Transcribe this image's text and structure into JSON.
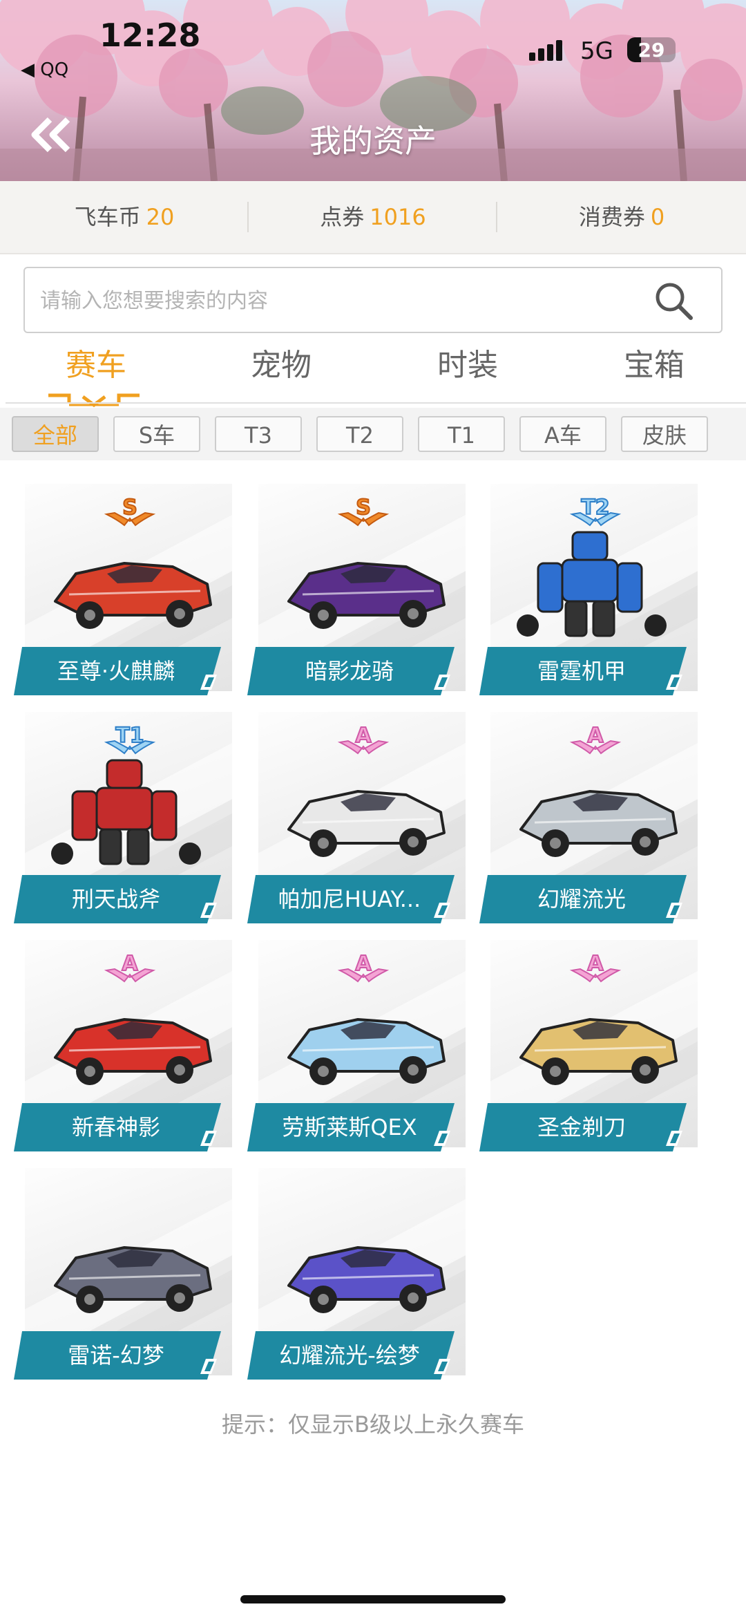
{
  "status": {
    "time": "12:28",
    "back_app": "◀ QQ",
    "network": "5G",
    "battery": "29",
    "battery_level": 0.29
  },
  "header": {
    "title": "我的资产"
  },
  "currency": [
    {
      "label": "飞车币",
      "value": "20"
    },
    {
      "label": "点券",
      "value": "1016"
    },
    {
      "label": "消费券",
      "value": "0"
    }
  ],
  "search": {
    "placeholder": "请输入您想要搜索的内容",
    "value": ""
  },
  "tabs": [
    {
      "label": "赛车",
      "active": true
    },
    {
      "label": "宠物",
      "active": false
    },
    {
      "label": "时装",
      "active": false
    },
    {
      "label": "宝箱",
      "active": false
    }
  ],
  "filters": [
    {
      "label": "全部",
      "active": true
    },
    {
      "label": "S车",
      "active": false
    },
    {
      "label": "T3",
      "active": false
    },
    {
      "label": "T2",
      "active": false
    },
    {
      "label": "T1",
      "active": false
    },
    {
      "label": "A车",
      "active": false
    },
    {
      "label": "皮肤",
      "active": false
    }
  ],
  "cars": [
    {
      "name": "至尊·火麒麟",
      "rank": "S",
      "icon": "fire-qilin-car-icon",
      "color": "#d8402a"
    },
    {
      "name": "暗影龙骑",
      "rank": "S",
      "icon": "shadow-dragon-car-icon",
      "color": "#5a2f8a"
    },
    {
      "name": "雷霆机甲",
      "rank": "T2",
      "icon": "thunder-mecha-icon",
      "color": "#2e6fd0"
    },
    {
      "name": "刑天战斧",
      "rank": "T1",
      "icon": "xingtian-axe-mecha-icon",
      "color": "#c42c2c"
    },
    {
      "name": "帕加尼HUAY...",
      "rank": "A",
      "icon": "pagani-car-icon",
      "color": "#e8e8e8"
    },
    {
      "name": "幻耀流光",
      "rank": "A",
      "icon": "streamer-car-icon",
      "color": "#bfc6cc"
    },
    {
      "name": "新春神影",
      "rank": "A",
      "icon": "spring-shadow-car-icon",
      "color": "#d8322a"
    },
    {
      "name": "劳斯莱斯QEX",
      "rank": "A",
      "icon": "rolls-royce-car-icon",
      "color": "#9fd0ee"
    },
    {
      "name": "圣金剃刀",
      "rank": "A",
      "icon": "golden-razor-car-icon",
      "color": "#e2c070"
    },
    {
      "name": "雷诺-幻梦",
      "rank": "",
      "icon": "renault-dream-car-icon",
      "color": "#6b6e80"
    },
    {
      "name": "幻耀流光-绘梦",
      "rank": "",
      "icon": "streamer-dream-car-icon",
      "color": "#5b52c8"
    }
  ],
  "hint": "提示：仅显示B级以上永久赛车",
  "colors": {
    "accent": "#f0a020",
    "band": "#1e8aa2"
  }
}
